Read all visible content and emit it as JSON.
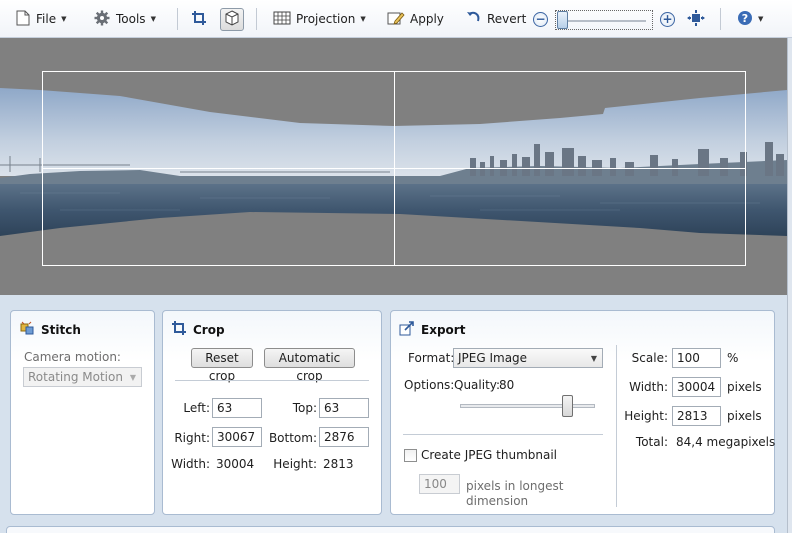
{
  "toolbar": {
    "file": "File",
    "tools": "Tools",
    "projection": "Projection",
    "apply": "Apply",
    "revert": "Revert",
    "zoom_level": 0,
    "help_icon": "help-icon"
  },
  "stitch": {
    "title": "Stitch",
    "camera_motion_label": "Camera motion:",
    "camera_motion_value": "Rotating Motion"
  },
  "crop": {
    "title": "Crop",
    "reset_label": "Reset crop",
    "auto_label": "Automatic crop",
    "left_label": "Left:",
    "left_value": "63",
    "top_label": "Top:",
    "top_value": "63",
    "right_label": "Right:",
    "right_value": "30067",
    "bottom_label": "Bottom:",
    "bottom_value": "2876",
    "width_label": "Width:",
    "width_value": "30004",
    "height_label": "Height:",
    "height_value": "2813"
  },
  "export": {
    "title": "Export",
    "format_label": "Format:",
    "format_value": "JPEG Image",
    "options_label": "Options:",
    "quality_label": "Quality:",
    "quality_value": "80",
    "thumbnail_label": "Create JPEG thumbnail",
    "thumbnail_checked": false,
    "thumb_pixels_value": "100",
    "thumb_pixels_label_1": "pixels in longest",
    "thumb_pixels_label_2": "dimension",
    "scale_label": "Scale:",
    "scale_value": "100",
    "scale_unit": "%",
    "width_label": "Width:",
    "width_value": "30004",
    "width_unit": "pixels",
    "height_label": "Height:",
    "height_value": "2813",
    "height_unit": "pixels",
    "total_label": "Total:",
    "total_value": "84,4 megapixels"
  },
  "colors": {
    "toolbar_icon_blue": "#3d66a3",
    "canvas_gray": "#808080",
    "panel_border": "#a9bbd1"
  }
}
